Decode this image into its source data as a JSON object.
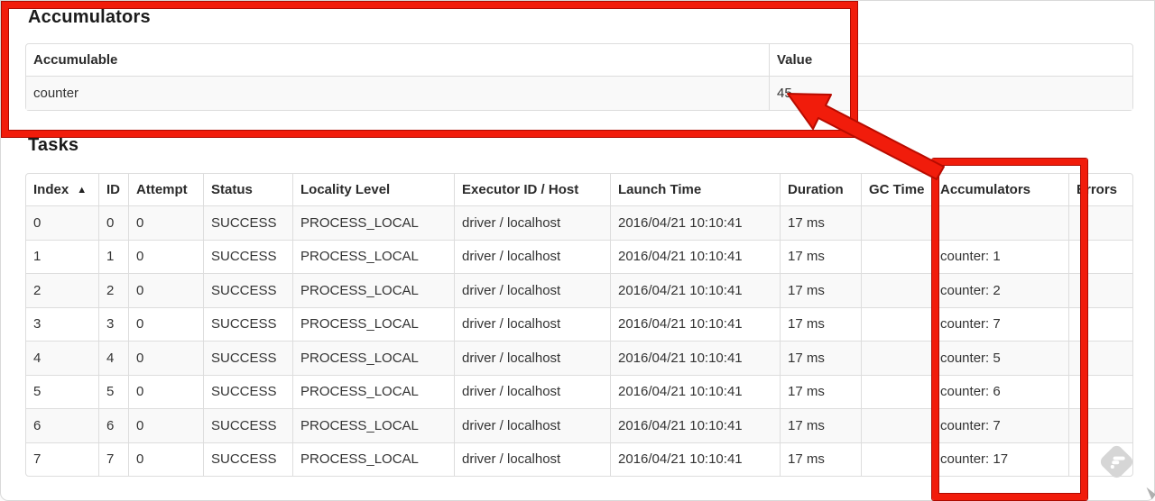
{
  "annotation_color": "#f11c0b",
  "accumulators_section": {
    "heading": "Accumulators",
    "table": {
      "columns": [
        "Accumulable",
        "Value"
      ],
      "rows": [
        {
          "accumulable": "counter",
          "value": "45"
        }
      ]
    }
  },
  "tasks_section": {
    "heading": "Tasks",
    "table": {
      "columns": [
        {
          "key": "index",
          "label": "Index",
          "sort_icon": "▲"
        },
        {
          "key": "id",
          "label": "ID"
        },
        {
          "key": "attempt",
          "label": "Attempt"
        },
        {
          "key": "status",
          "label": "Status"
        },
        {
          "key": "locality-level",
          "label": "Locality Level"
        },
        {
          "key": "executor-id-host",
          "label": "Executor ID / Host"
        },
        {
          "key": "launch-time",
          "label": "Launch Time"
        },
        {
          "key": "duration",
          "label": "Duration"
        },
        {
          "key": "gc-time",
          "label": "GC Time"
        },
        {
          "key": "accumulators",
          "label": "Accumulators"
        },
        {
          "key": "errors",
          "label": "Errors"
        }
      ],
      "rows": [
        [
          "0",
          "0",
          "0",
          "SUCCESS",
          "PROCESS_LOCAL",
          "driver / localhost",
          "2016/04/21 10:10:41",
          "17 ms",
          "",
          "",
          ""
        ],
        [
          "1",
          "1",
          "0",
          "SUCCESS",
          "PROCESS_LOCAL",
          "driver / localhost",
          "2016/04/21 10:10:41",
          "17 ms",
          "",
          "counter: 1",
          ""
        ],
        [
          "2",
          "2",
          "0",
          "SUCCESS",
          "PROCESS_LOCAL",
          "driver / localhost",
          "2016/04/21 10:10:41",
          "17 ms",
          "",
          "counter: 2",
          ""
        ],
        [
          "3",
          "3",
          "0",
          "SUCCESS",
          "PROCESS_LOCAL",
          "driver / localhost",
          "2016/04/21 10:10:41",
          "17 ms",
          "",
          "counter: 7",
          ""
        ],
        [
          "4",
          "4",
          "0",
          "SUCCESS",
          "PROCESS_LOCAL",
          "driver / localhost",
          "2016/04/21 10:10:41",
          "17 ms",
          "",
          "counter: 5",
          ""
        ],
        [
          "5",
          "5",
          "0",
          "SUCCESS",
          "PROCESS_LOCAL",
          "driver / localhost",
          "2016/04/21 10:10:41",
          "17 ms",
          "",
          "counter: 6",
          ""
        ],
        [
          "6",
          "6",
          "0",
          "SUCCESS",
          "PROCESS_LOCAL",
          "driver / localhost",
          "2016/04/21 10:10:41",
          "17 ms",
          "",
          "counter: 7",
          ""
        ],
        [
          "7",
          "7",
          "0",
          "SUCCESS",
          "PROCESS_LOCAL",
          "driver / localhost",
          "2016/04/21 10:10:41",
          "17 ms",
          "",
          "counter: 17",
          ""
        ]
      ]
    }
  }
}
